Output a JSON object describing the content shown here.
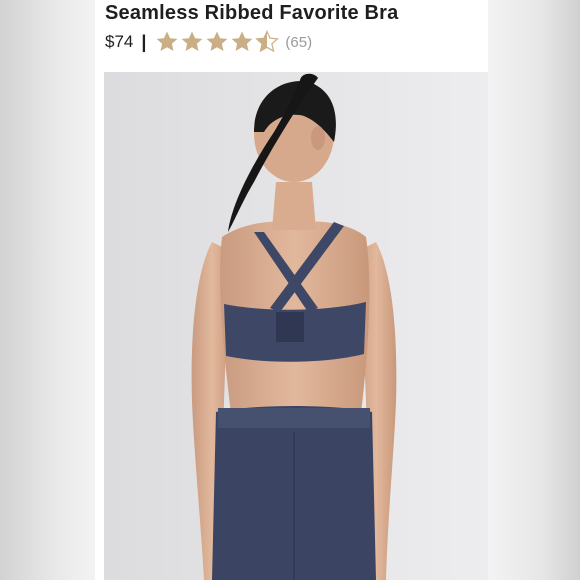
{
  "product": {
    "title": "Seamless Ribbed Favorite Bra",
    "price": "$74",
    "separator": "|",
    "rating": 4.5,
    "rating_max": 5,
    "review_count": "(65)",
    "star_color": "#c9ae86",
    "star_empty_color": "#d9d9d9"
  },
  "image": {
    "subject": "woman-back-view-photo",
    "bra_color": "#3e4866",
    "background_color": "#e6e6e8"
  }
}
